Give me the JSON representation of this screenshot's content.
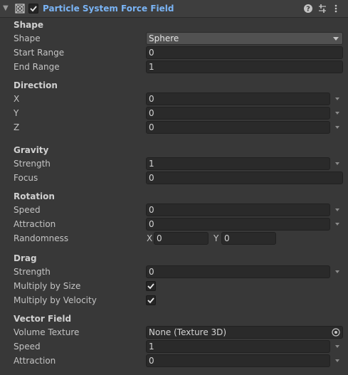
{
  "header": {
    "title": "Particle System Force Field",
    "enabled": true,
    "icons": [
      "foldout-arrow-icon",
      "force-field-component-icon",
      "help-icon",
      "preset-sliders-icon",
      "kebab-menu-icon"
    ]
  },
  "shape": {
    "section": "Shape",
    "shape_label": "Shape",
    "shape_value": "Sphere",
    "start_range_label": "Start Range",
    "start_range_value": "0",
    "end_range_label": "End Range",
    "end_range_value": "1"
  },
  "direction": {
    "section": "Direction",
    "x_label": "X",
    "x_value": "0",
    "y_label": "Y",
    "y_value": "0",
    "z_label": "Z",
    "z_value": "0"
  },
  "gravity": {
    "section": "Gravity",
    "strength_label": "Strength",
    "strength_value": "1",
    "focus_label": "Focus",
    "focus_value": "0"
  },
  "rotation": {
    "section": "Rotation",
    "speed_label": "Speed",
    "speed_value": "0",
    "attraction_label": "Attraction",
    "attraction_value": "0",
    "randomness_label": "Randomness",
    "randomness_x_label": "X",
    "randomness_x_value": "0",
    "randomness_y_label": "Y",
    "randomness_y_value": "0"
  },
  "drag": {
    "section": "Drag",
    "strength_label": "Strength",
    "strength_value": "0",
    "multiply_size_label": "Multiply by Size",
    "multiply_size_checked": true,
    "multiply_velocity_label": "Multiply by Velocity",
    "multiply_velocity_checked": true
  },
  "vector_field": {
    "section": "Vector Field",
    "volume_texture_label": "Volume Texture",
    "volume_texture_value": "None (Texture 3D)",
    "speed_label": "Speed",
    "speed_value": "1",
    "attraction_label": "Attraction",
    "attraction_value": "0"
  },
  "colors": {
    "background": "#383838",
    "field": "#2a2a2a",
    "title_accent": "#7ab4f5"
  }
}
